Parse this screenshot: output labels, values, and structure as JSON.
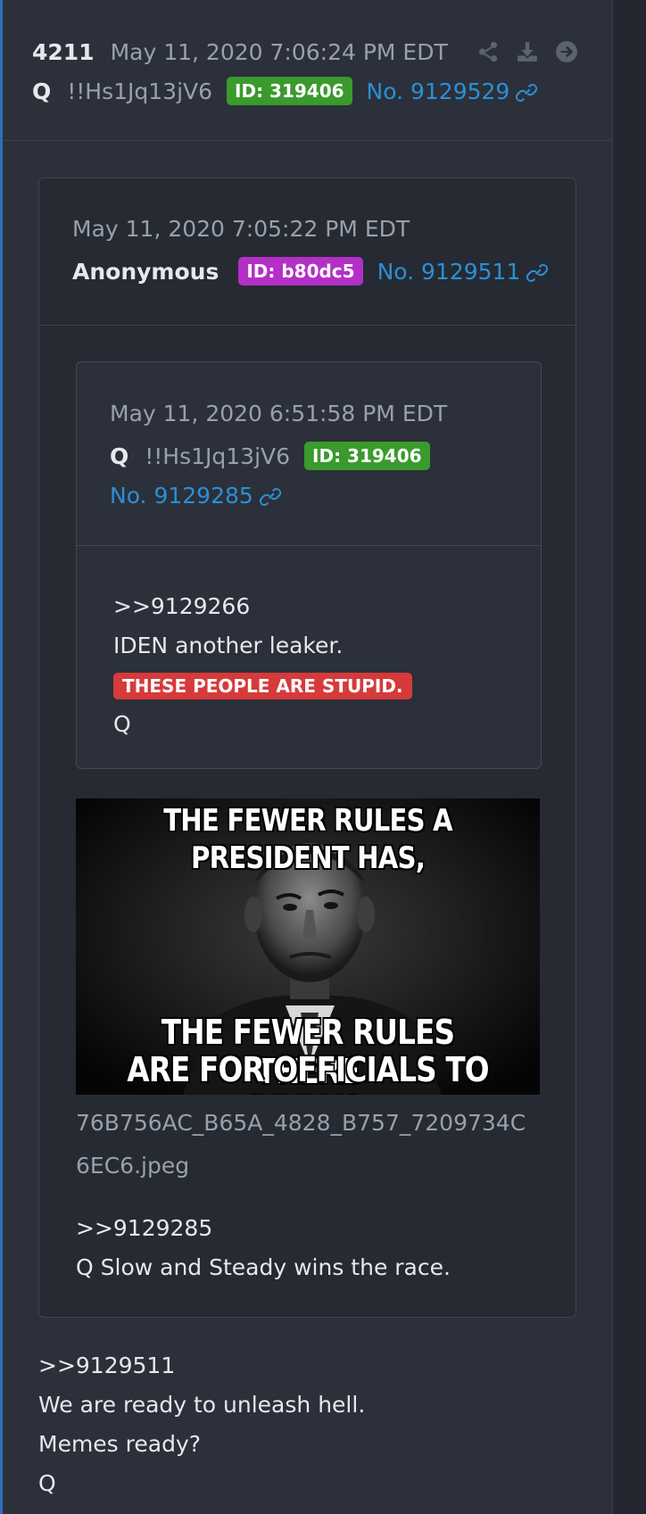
{
  "post": {
    "number": "4211",
    "date": "May 11, 2020 7:06:24 PM EDT",
    "author": "Q",
    "tripcode": "!!Hs1Jq13jV6",
    "id_badge": "ID: 319406",
    "id_color": "#3a9a2c",
    "post_no": "No. 9129529",
    "actions": [
      "share-icon",
      "download-icon",
      "arrow-right-circle-icon"
    ],
    "body": [
      ">>9129511",
      "We are ready to unleash hell.",
      "Memes ready?",
      "Q"
    ]
  },
  "quoted_post": {
    "date": "May 11, 2020 7:05:22 PM EDT",
    "author": "Anonymous",
    "id_badge": "ID: b80dc5",
    "id_color": "#b42fc7",
    "post_no": "No. 9129511",
    "image": {
      "caption_top": "THE FEWER RULES A PRESIDENT HAS,",
      "caption_bottom_1": "THE FEWER RULES THERE",
      "caption_bottom_2": "ARE FOR OFFICIALS TO BREAK.",
      "filename": "76B756AC_B65A_4828_B757_7209734C6EC6.jpeg"
    },
    "body": [
      ">>9129285",
      "Q Slow and Steady wins the race."
    ]
  },
  "nested_quote": {
    "date": "May 11, 2020 6:51:58 PM EDT",
    "author": "Q",
    "tripcode": "!!Hs1Jq13jV6",
    "id_badge": "ID: 319406",
    "id_color": "#3a9a2c",
    "post_no": "No. 9129285",
    "body_ref": ">>9129266",
    "body_line": "IDEN another leaker.",
    "highlight": "THESE PEOPLE ARE STUPID.",
    "highlight_color": "#d63a3a",
    "signature": "Q"
  }
}
